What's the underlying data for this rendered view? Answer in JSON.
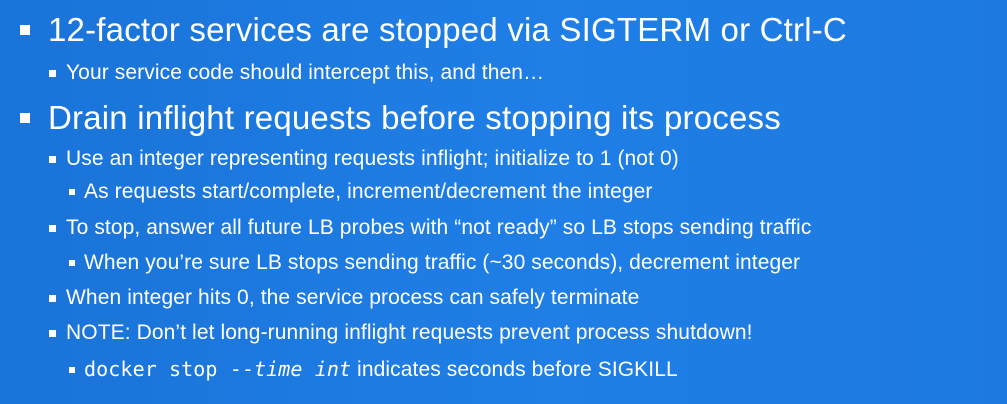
{
  "slide": {
    "background_color": "#1e7be0",
    "text_color": "#ffffff",
    "bullets": [
      {
        "level": 1,
        "text": "12-factor services are stopped via SIGTERM or Ctrl-C"
      },
      {
        "level": 2,
        "text": "Your service code should intercept this, and then…"
      },
      {
        "level": 1,
        "text": "Drain inflight requests before stopping its process"
      },
      {
        "level": 2,
        "text": "Use an integer representing requests inflight; initialize to 1 (not 0)"
      },
      {
        "level": 3,
        "text": "As requests start/complete, increment/decrement the integer"
      },
      {
        "level": 2,
        "text": "To stop, answer all future LB probes with “not ready” so LB stops sending traffic"
      },
      {
        "level": 3,
        "text": "When you’re sure LB stops sending traffic (~30 seconds), decrement integer"
      },
      {
        "level": 2,
        "text": "When integer hits 0, the service process can safely terminate"
      },
      {
        "level": 2,
        "text": "NOTE: Don’t let long-running inflight requests prevent process shutdown!"
      },
      {
        "level": 3,
        "parts": {
          "code_cmd": "docker stop --",
          "code_arg": "time int",
          "rest": " indicates seconds before SIGKILL"
        }
      }
    ]
  }
}
